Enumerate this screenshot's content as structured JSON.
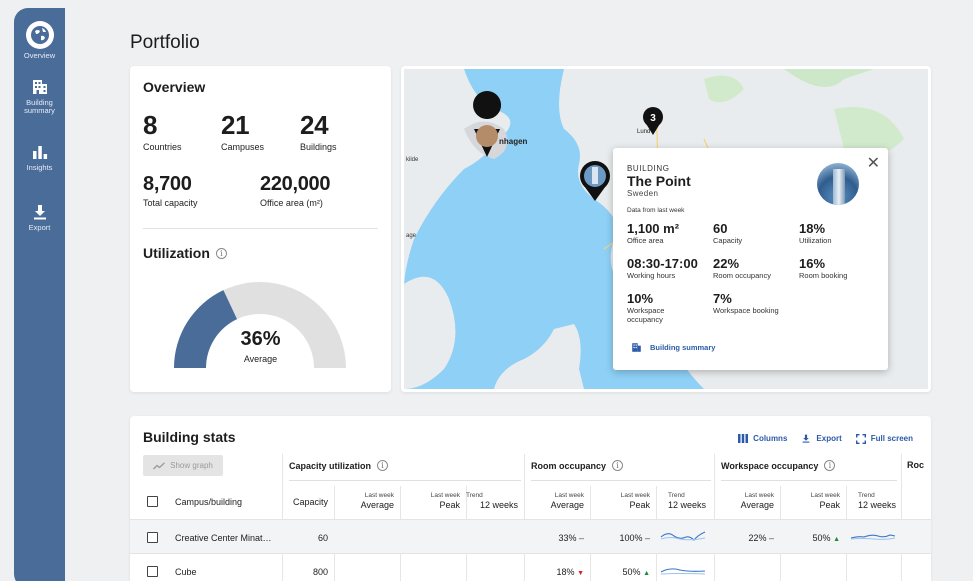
{
  "sidebar": {
    "items": [
      {
        "label": "Overview"
      },
      {
        "label": "Building summary"
      },
      {
        "label": "Insights"
      },
      {
        "label": "Export"
      }
    ]
  },
  "page": {
    "title": "Portfolio"
  },
  "overview": {
    "title": "Overview",
    "stats": [
      {
        "value": "8",
        "label": "Countries"
      },
      {
        "value": "21",
        "label": "Campuses"
      },
      {
        "value": "24",
        "label": "Buildings"
      },
      {
        "value": "8,700",
        "label": "Total capacity"
      },
      {
        "value": "220,000",
        "label": "Office area (m²)"
      }
    ],
    "utilization": {
      "title": "Utilization",
      "value": "36%",
      "fraction": 0.36,
      "label": "Average"
    }
  },
  "map": {
    "cluster_count": "3",
    "place_labels": [
      "nhagen",
      "Lund",
      "kilde",
      "age"
    ],
    "popup": {
      "type": "BUILDING",
      "name": "The Point",
      "country": "Sweden",
      "subtitle": "Data from last week",
      "metrics": [
        {
          "value": "1,100 m²",
          "label": "Office area"
        },
        {
          "value": "60",
          "label": "Capacity"
        },
        {
          "value": "18%",
          "label": "Utilization"
        },
        {
          "value": "08:30-17:00",
          "label": "Working hours"
        },
        {
          "value": "22%",
          "label": "Room occupancy"
        },
        {
          "value": "16%",
          "label": "Room booking"
        },
        {
          "value": "10%",
          "label": "Workspace occupancy"
        },
        {
          "value": "7%",
          "label": "Workspace booking"
        }
      ],
      "link": "Building summary",
      "close": "✕"
    }
  },
  "stats": {
    "title": "Building stats",
    "tools": {
      "columns": "Columns",
      "export": "Export",
      "fullscreen": "Full screen"
    },
    "show_graph": "Show graph",
    "groups": {
      "capacity": "Capacity utilization",
      "room": "Room occupancy",
      "workspace": "Workspace occupancy",
      "cut": "Roc"
    },
    "columns": {
      "campus": "Campus/building",
      "capacity": "Capacity",
      "lw": "Last week",
      "avg": "Average",
      "peak": "Peak",
      "trend": "Trend",
      "weeks": "12 weeks"
    },
    "rows": [
      {
        "name": "Creative Center Minat…",
        "capacity": "60",
        "room_avg": "33%",
        "room_avg_trend": "–",
        "room_peak": "100%",
        "room_peak_trend": "–",
        "ws_avg": "22%",
        "ws_avg_trend": "–",
        "ws_peak": "50%",
        "ws_peak_trend": "▲"
      },
      {
        "name": "Cube",
        "capacity": "800",
        "room_avg": "18%",
        "room_avg_trend": "▼",
        "room_peak": "50%",
        "room_peak_trend": "▲",
        "ws_avg": "",
        "ws_avg_trend": "",
        "ws_peak": "",
        "ws_peak_trend": ""
      }
    ]
  }
}
